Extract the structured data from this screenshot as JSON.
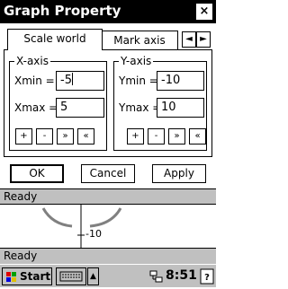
{
  "window": {
    "title": "Graph Property",
    "close_label": "×"
  },
  "tabs": [
    {
      "label": "Scale world",
      "active": true
    },
    {
      "label": "Mark axis",
      "active": false
    }
  ],
  "tab_scroll": {
    "left": "◄",
    "right": "►"
  },
  "x_axis": {
    "legend": "X-axis",
    "min_label": "Xmin =",
    "min_value": "-5",
    "max_label": "Xmax =",
    "max_value": "5"
  },
  "y_axis": {
    "legend": "Y-axis",
    "min_label": "Ymin =",
    "min_value": "-10",
    "max_label": "Ymax =",
    "max_value": "10"
  },
  "step_buttons": [
    "+",
    "-",
    "»",
    "«"
  ],
  "dialog_buttons": {
    "ok": "OK",
    "cancel": "Cancel",
    "apply": "Apply"
  },
  "status_top": "Ready",
  "graph": {
    "tick_label": "-10"
  },
  "status_bottom": "Ready",
  "taskbar": {
    "start_label": "Start",
    "time": "8:51"
  },
  "icons": [
    "close-icon",
    "windows-flag-icon",
    "keyboard-icon",
    "up-arrow-icon",
    "network-icon",
    "help-icon"
  ]
}
